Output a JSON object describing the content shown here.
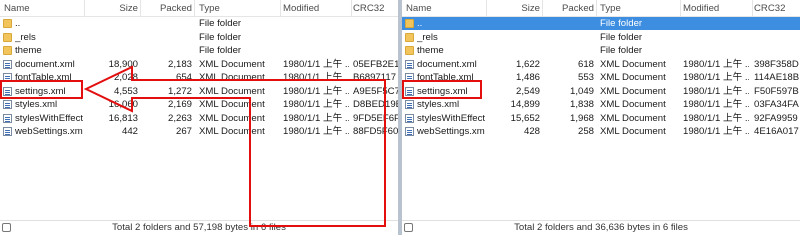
{
  "columns": {
    "name": "Name",
    "size": "Size",
    "packed": "Packed",
    "type": "Type",
    "modified": "Modified",
    "crc": "CRC32"
  },
  "left": {
    "rows": [
      {
        "icon": "folder",
        "name": "..",
        "size": "",
        "packed": "",
        "type": "File folder",
        "modified": "",
        "crc": ""
      },
      {
        "icon": "folder",
        "name": "_rels",
        "size": "",
        "packed": "",
        "type": "File folder",
        "modified": "",
        "crc": ""
      },
      {
        "icon": "folder",
        "name": "theme",
        "size": "",
        "packed": "",
        "type": "File folder",
        "modified": "",
        "crc": ""
      },
      {
        "icon": "file",
        "name": "document.xml",
        "size": "18,900",
        "packed": "2,183",
        "type": "XML Document",
        "modified": "1980/1/1 上午 ...",
        "crc": "05EFB2E1"
      },
      {
        "icon": "file",
        "name": "fontTable.xml",
        "size": "2,028",
        "packed": "654",
        "type": "XML Document",
        "modified": "1980/1/1 上午 ...",
        "crc": "B6897117"
      },
      {
        "icon": "file",
        "name": "settings.xml",
        "size": "4,553",
        "packed": "1,272",
        "type": "XML Document",
        "modified": "1980/1/1 上午 ...",
        "crc": "A9E5F5C7"
      },
      {
        "icon": "file",
        "name": "styles.xml",
        "size": "16,060",
        "packed": "2,169",
        "type": "XML Document",
        "modified": "1980/1/1 上午 ...",
        "crc": "D8BED19E"
      },
      {
        "icon": "file",
        "name": "stylesWithEffects...",
        "size": "16,813",
        "packed": "2,263",
        "type": "XML Document",
        "modified": "1980/1/1 上午 ...",
        "crc": "9FD5EF6F"
      },
      {
        "icon": "file",
        "name": "webSettings.xml",
        "size": "442",
        "packed": "267",
        "type": "XML Document",
        "modified": "1980/1/1 上午 ...",
        "crc": "88FD5F60"
      }
    ],
    "status": "Total 2 folders and 57,198 bytes in 6 files"
  },
  "right": {
    "rows": [
      {
        "icon": "folder",
        "name": "..",
        "size": "",
        "packed": "",
        "type": "File folder",
        "modified": "",
        "crc": "",
        "selected": true
      },
      {
        "icon": "folder",
        "name": "_rels",
        "size": "",
        "packed": "",
        "type": "File folder",
        "modified": "",
        "crc": ""
      },
      {
        "icon": "folder",
        "name": "theme",
        "size": "",
        "packed": "",
        "type": "File folder",
        "modified": "",
        "crc": ""
      },
      {
        "icon": "file",
        "name": "document.xml",
        "size": "1,622",
        "packed": "618",
        "type": "XML Document",
        "modified": "1980/1/1 上午 ...",
        "crc": "398F358D"
      },
      {
        "icon": "file",
        "name": "fontTable.xml",
        "size": "1,486",
        "packed": "553",
        "type": "XML Document",
        "modified": "1980/1/1 上午 ...",
        "crc": "114AE18B"
      },
      {
        "icon": "file",
        "name": "settings.xml",
        "size": "2,549",
        "packed": "1,049",
        "type": "XML Document",
        "modified": "1980/1/1 上午 ...",
        "crc": "F50F597B"
      },
      {
        "icon": "file",
        "name": "styles.xml",
        "size": "14,899",
        "packed": "1,838",
        "type": "XML Document",
        "modified": "1980/1/1 上午 ...",
        "crc": "03FA34FA"
      },
      {
        "icon": "file",
        "name": "stylesWithEffects...",
        "size": "15,652",
        "packed": "1,968",
        "type": "XML Document",
        "modified": "1980/1/1 上午 ...",
        "crc": "92FA9959"
      },
      {
        "icon": "file",
        "name": "webSettings.xml",
        "size": "428",
        "packed": "258",
        "type": "XML Document",
        "modified": "1980/1/1 上午 ...",
        "crc": "4E16A017"
      }
    ],
    "status": "Total 2 folders and 36,636 bytes in 6 files"
  },
  "colors": {
    "selection": "#3d8ee0",
    "highlight": "#e30f0f",
    "folder": "#f2c55c"
  }
}
